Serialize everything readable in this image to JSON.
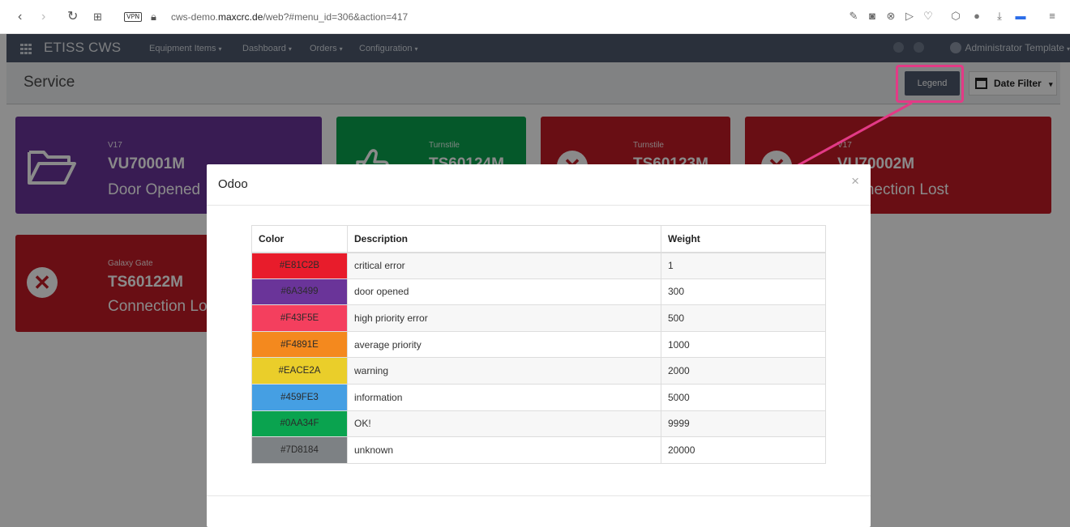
{
  "browser": {
    "url_prefix": "cws-demo.",
    "url_domain": "maxcrc.de",
    "url_path": "/web?#menu_id=306&action=417",
    "vpn_label": "VPN"
  },
  "nav": {
    "brand": "ETISS CWS",
    "menus": [
      "Equipment Items",
      "Dashboard",
      "Orders",
      "Configuration"
    ],
    "user": "Administrator Template"
  },
  "cpanel": {
    "title": "Service",
    "legend_button": "Legend",
    "date_filter": "Date Filter"
  },
  "cards": [
    {
      "sub": "V17",
      "code": "VU70001M",
      "status": "Door Opened",
      "color": "#6A3499",
      "icon": "folder-open-icon"
    },
    {
      "sub": "Turnstile",
      "code": "TS60124M",
      "status": "",
      "color": "#0AA34F",
      "icon": "thumbs-up-icon"
    },
    {
      "sub": "Turnstile",
      "code": "TS60123M",
      "status": "",
      "color": "#C21A25",
      "icon": "x-circle-icon"
    },
    {
      "sub": "V17",
      "code": "VU70002M",
      "status": "Connection Lost",
      "color": "#C21A25",
      "icon": "x-circle-icon"
    },
    {
      "sub": "Galaxy Gate",
      "code": "TS60122M",
      "status": "Connection Lost",
      "color": "#C21A25",
      "icon": "x-circle-icon"
    }
  ],
  "modal": {
    "title": "Odoo",
    "close": "×",
    "headers": {
      "color": "Color",
      "description": "Description",
      "weight": "Weight"
    },
    "rows": [
      {
        "color": "#E81C2B",
        "description": "critical error",
        "weight": "1"
      },
      {
        "color": "#6A3499",
        "description": "door opened",
        "weight": "300"
      },
      {
        "color": "#F43F5E",
        "description": "high priority error",
        "weight": "500"
      },
      {
        "color": "#F4891E",
        "description": "average priority",
        "weight": "1000"
      },
      {
        "color": "#EACE2A",
        "description": "warning",
        "weight": "2000"
      },
      {
        "color": "#459FE3",
        "description": "information",
        "weight": "5000"
      },
      {
        "color": "#0AA34F",
        "description": "OK!",
        "weight": "9999"
      },
      {
        "color": "#7D8184",
        "description": "unknown",
        "weight": "20000"
      }
    ]
  },
  "annotation": {
    "highlight_color": "#E33A86"
  }
}
